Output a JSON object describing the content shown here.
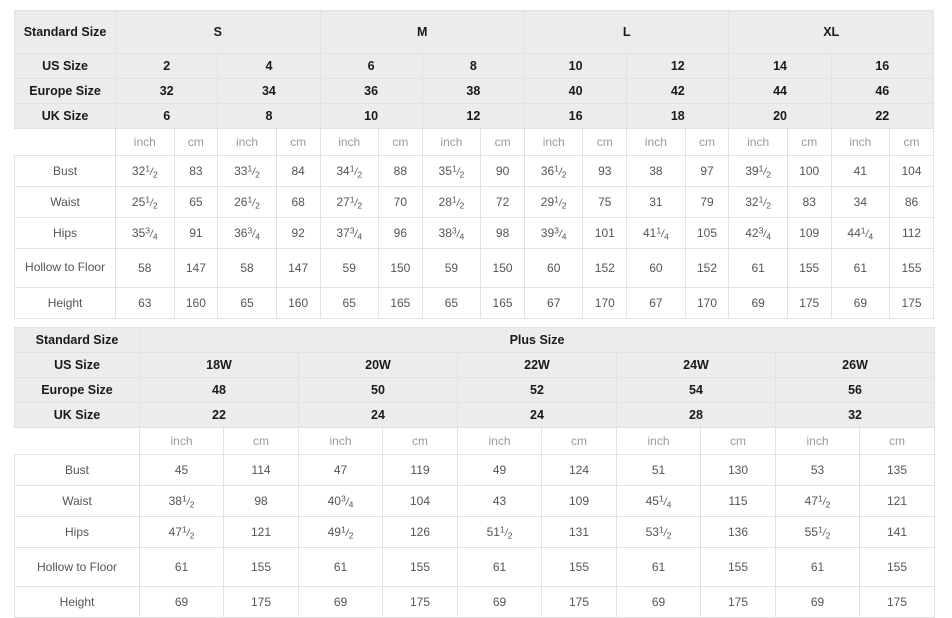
{
  "standard_table": {
    "corner_label": "Standard Size",
    "row_labels": {
      "us": "US Size",
      "europe": "Europe Size",
      "uk": "UK Size",
      "bust": "Bust",
      "waist": "Waist",
      "hips": "Hips",
      "hollow": "Hollow to Floor",
      "height": "Height"
    },
    "units": [
      "inch",
      "cm",
      "inch",
      "cm",
      "inch",
      "cm",
      "inch",
      "cm",
      "inch",
      "cm",
      "inch",
      "cm",
      "inch",
      "cm",
      "inch",
      "cm"
    ],
    "size_groups": [
      "S",
      "M",
      "L",
      "XL"
    ],
    "us_sizes": [
      "2",
      "4",
      "6",
      "8",
      "10",
      "12",
      "14",
      "16"
    ],
    "europe_sizes": [
      "32",
      "34",
      "36",
      "38",
      "40",
      "42",
      "44",
      "46"
    ],
    "uk_sizes": [
      "6",
      "8",
      "10",
      "12",
      "16",
      "18",
      "20",
      "22"
    ],
    "bust": [
      "32 1/2",
      "83",
      "33 1/2",
      "84",
      "34 1/2",
      "88",
      "35 1/2",
      "90",
      "36 1/2",
      "93",
      "38",
      "97",
      "39 1/2",
      "100",
      "41",
      "104"
    ],
    "waist": [
      "25 1/2",
      "65",
      "26 1/2",
      "68",
      "27 1/2",
      "70",
      "28 1/2",
      "72",
      "29 1/2",
      "75",
      "31",
      "79",
      "32 1/2",
      "83",
      "34",
      "86"
    ],
    "hips": [
      "35 3/4",
      "91",
      "36 3/4",
      "92",
      "37 3/4",
      "96",
      "38 3/4",
      "98",
      "39 3/4",
      "101",
      "41 1/4",
      "105",
      "42 3/4",
      "109",
      "44 1/4",
      "112"
    ],
    "hollow_to_floor": [
      "58",
      "147",
      "58",
      "147",
      "59",
      "150",
      "59",
      "150",
      "60",
      "152",
      "60",
      "152",
      "61",
      "155",
      "61",
      "155"
    ],
    "height": [
      "63",
      "160",
      "65",
      "160",
      "65",
      "165",
      "65",
      "165",
      "67",
      "170",
      "67",
      "170",
      "69",
      "175",
      "69",
      "175"
    ]
  },
  "plus_table": {
    "corner_label": "Standard Size",
    "group_label": "Plus Size",
    "row_labels": {
      "us": "US Size",
      "europe": "Europe Size",
      "uk": "UK Size",
      "bust": "Bust",
      "waist": "Waist",
      "hips": "Hips",
      "hollow": "Hollow to Floor",
      "height": "Height"
    },
    "units": [
      "inch",
      "cm",
      "inch",
      "cm",
      "inch",
      "cm",
      "inch",
      "cm",
      "inch",
      "cm"
    ],
    "us_sizes": [
      "18W",
      "20W",
      "22W",
      "24W",
      "26W"
    ],
    "europe_sizes": [
      "48",
      "50",
      "52",
      "54",
      "56"
    ],
    "uk_sizes": [
      "22",
      "24",
      "24",
      "28",
      "32"
    ],
    "bust": [
      "45",
      "114",
      "47",
      "119",
      "49",
      "124",
      "51",
      "130",
      "53",
      "135"
    ],
    "waist": [
      "38 1/2",
      "98",
      "40 3/4",
      "104",
      "43",
      "109",
      "45 1/4",
      "115",
      "47 1/2",
      "121"
    ],
    "hips": [
      "47 1/2",
      "121",
      "49 1/2",
      "126",
      "51 1/2",
      "131",
      "53 1/2",
      "136",
      "55 1/2",
      "141"
    ],
    "hollow_to_floor": [
      "61",
      "155",
      "61",
      "155",
      "61",
      "155",
      "61",
      "155",
      "61",
      "155"
    ],
    "height": [
      "69",
      "175",
      "69",
      "175",
      "69",
      "175",
      "69",
      "175",
      "69",
      "175"
    ]
  },
  "colors": {
    "header_bg": "#ececec",
    "border": "#e2e2e2",
    "header_text": "#1a1a1a",
    "data_text": "#555555",
    "label_text": "#777777",
    "unit_text": "#9a9a9a"
  }
}
